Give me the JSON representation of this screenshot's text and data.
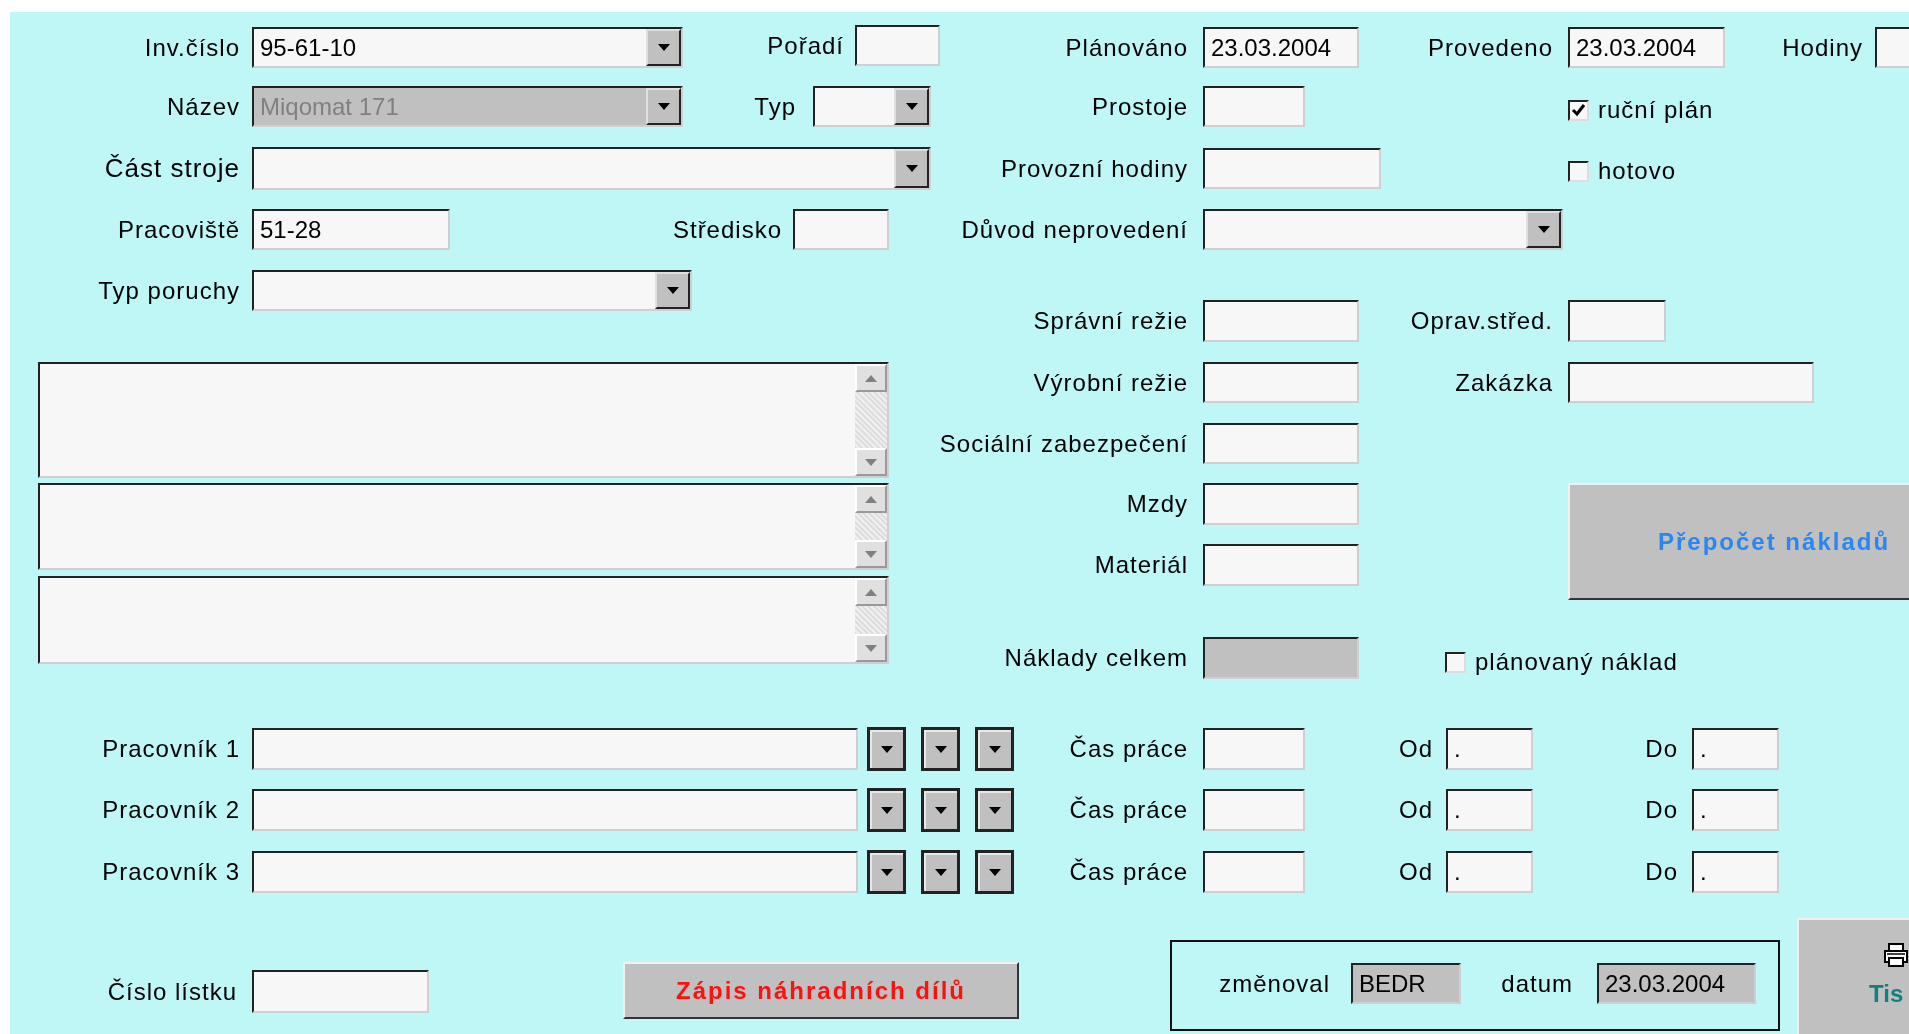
{
  "fields": [
    {
      "kind": "combo",
      "label": "Inv.číslo",
      "value": "95-61-10",
      "disabled": false,
      "locked": false
    },
    {
      "kind": "text",
      "label": "Pořadí",
      "disabled": false,
      "locked": false
    },
    {
      "kind": "text",
      "label": "Plánováno",
      "value": "23.03.2004",
      "disabled": false,
      "locked": false
    },
    {
      "kind": "text",
      "label": "Provedeno",
      "value": "23.03.2004",
      "disabled": false,
      "locked": false
    },
    {
      "kind": "text",
      "label": "Hodiny",
      "disabled": false,
      "locked": false
    },
    {
      "kind": "combo",
      "label": "Název",
      "value": "Miqomat 171",
      "disabled": true,
      "locked": false
    },
    {
      "kind": "combo",
      "label": "Typ",
      "disabled": false,
      "locked": false
    },
    {
      "kind": "text",
      "label": "Prostoje",
      "disabled": false,
      "locked": false
    },
    {
      "kind": "checkbox",
      "label": "ruční plán",
      "checked": true
    },
    {
      "kind": "combo",
      "label": "Část stroje",
      "disabled": false,
      "locked": false
    },
    {
      "kind": "text",
      "label": "Provozní hodiny",
      "disabled": false,
      "locked": false
    },
    {
      "kind": "checkbox",
      "label": "hotovo",
      "checked": false
    },
    {
      "kind": "text",
      "label": "Pracoviště",
      "value": "51-28",
      "disabled": false,
      "locked": false
    },
    {
      "kind": "text",
      "label": "Středisko",
      "disabled": false,
      "locked": false
    },
    {
      "kind": "combo",
      "label": "Důvod neprovedení",
      "disabled": false,
      "locked": false
    },
    {
      "kind": "combo",
      "label": "Typ poruchy",
      "disabled": false,
      "locked": false
    },
    {
      "kind": "text",
      "label": "Správní režie",
      "disabled": false,
      "locked": false
    },
    {
      "kind": "text",
      "label": "Oprav.střed.",
      "disabled": false,
      "locked": false
    },
    {
      "kind": "text",
      "label": "Výrobní režie",
      "disabled": false,
      "locked": false
    },
    {
      "kind": "text",
      "label": "Zakázka",
      "disabled": false,
      "locked": false
    },
    {
      "kind": "text",
      "label": "Sociální zabezpečení",
      "disabled": false,
      "locked": false
    },
    {
      "kind": "text",
      "label": "Mzdy",
      "disabled": false,
      "locked": false
    },
    {
      "kind": "text",
      "label": "Materiál",
      "disabled": false,
      "locked": false
    },
    {
      "kind": "text",
      "label": "Náklady celkem",
      "disabled": false,
      "locked": true
    },
    {
      "kind": "checkbox",
      "label": "plánovaný náklad",
      "checked": false
    },
    {
      "kind": "text",
      "label": "Pracovník 1",
      "disabled": false,
      "locked": false
    },
    {
      "kind": "dropdown"
    },
    {
      "kind": "dropdown"
    },
    {
      "kind": "dropdown"
    },
    {
      "kind": "text",
      "label": "Čas práce",
      "disabled": false,
      "locked": false
    },
    {
      "kind": "text",
      "label": "Od",
      "value": ".",
      "disabled": false,
      "locked": false
    },
    {
      "kind": "text",
      "label": "Do",
      "value": ".",
      "disabled": false,
      "locked": false
    },
    {
      "kind": "text",
      "label": "Pracovník 2",
      "disabled": false,
      "locked": false
    },
    {
      "kind": "dropdown"
    },
    {
      "kind": "dropdown"
    },
    {
      "kind": "dropdown"
    },
    {
      "kind": "text",
      "label": "Čas práce",
      "disabled": false,
      "locked": false
    },
    {
      "kind": "text",
      "label": "Od",
      "value": ".",
      "disabled": false,
      "locked": false
    },
    {
      "kind": "text",
      "label": "Do",
      "value": ".",
      "disabled": false,
      "locked": false
    },
    {
      "kind": "text",
      "label": "Pracovník 3",
      "disabled": false,
      "locked": false
    },
    {
      "kind": "dropdown"
    },
    {
      "kind": "dropdown"
    },
    {
      "kind": "dropdown"
    },
    {
      "kind": "text",
      "label": "Čas práce",
      "disabled": false,
      "locked": false
    },
    {
      "kind": "text",
      "label": "Od",
      "value": ".",
      "disabled": false,
      "locked": false
    },
    {
      "kind": "text",
      "label": "Do",
      "value": ".",
      "disabled": false,
      "locked": false
    },
    {
      "kind": "text",
      "label": "Číslo lístku",
      "disabled": false,
      "locked": false
    },
    {
      "kind": "text",
      "label": "změnoval",
      "value": "BEDR",
      "disabled": false,
      "locked": true
    },
    {
      "kind": "text",
      "label": "datum",
      "value": "23.03.2004",
      "disabled": false,
      "locked": true
    }
  ],
  "buttons": [
    {
      "kind": "recalc",
      "label": "Přepočet nákladů"
    },
    {
      "kind": "parts",
      "label": "Zápis náhradních dílů"
    },
    {
      "kind": "print",
      "label": "Tis"
    }
  ]
}
